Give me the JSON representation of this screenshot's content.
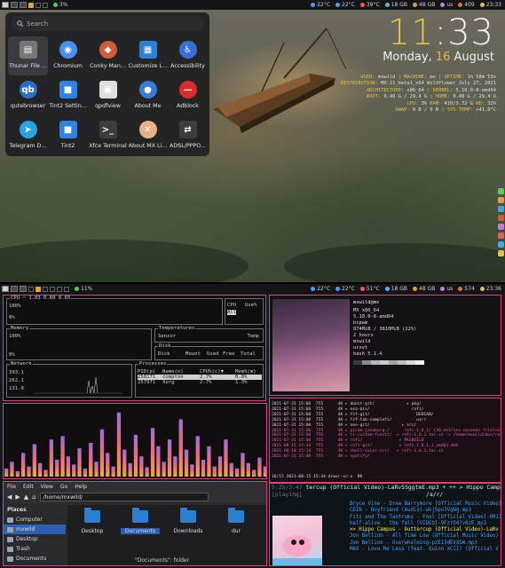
{
  "top_bar": {
    "cpu": "3%",
    "tray": [
      "22°C",
      "22°C",
      "39°C",
      "18 GB",
      "48 GB",
      "us",
      "409"
    ],
    "clock": "23:33"
  },
  "launcher": {
    "search_placeholder": "Search",
    "apps": [
      {
        "name": "Thunar File ...",
        "icon": "file-manager-icon",
        "color": "#777777",
        "glyph": "▤"
      },
      {
        "name": "Chromium",
        "icon": "chromium-icon",
        "color": "#4a8ef0",
        "glyph": "◉"
      },
      {
        "name": "Conky Man...",
        "icon": "conky-manager-icon",
        "color": "#d35c3a",
        "glyph": "◆"
      },
      {
        "name": "Customize L...",
        "icon": "customize-look-icon",
        "color": "#2d80d8",
        "glyph": "▦"
      },
      {
        "name": "Accessibility",
        "icon": "accessibility-icon",
        "color": "#3b6fd6",
        "glyph": "♿"
      },
      {
        "name": "qutebrowser",
        "icon": "qutebrowser-icon",
        "color": "#2e6fc1",
        "glyph": "qb"
      },
      {
        "name": "Tint2 Settin...",
        "icon": "tint2-settings-icon",
        "color": "#2f82e0",
        "glyph": "■"
      },
      {
        "name": "qpdfview",
        "icon": "qpdfview-icon",
        "color": "#dfdfdf",
        "glyph": "▣"
      },
      {
        "name": "About Me",
        "icon": "user-icon",
        "color": "#3a7bd5",
        "glyph": "●"
      },
      {
        "name": "Adblock",
        "icon": "adblock-icon",
        "color": "#d62e2e",
        "glyph": "—"
      },
      {
        "name": "Telegram D...",
        "icon": "telegram-icon",
        "color": "#2aa3e3",
        "glyph": "➤"
      },
      {
        "name": "Tint2",
        "icon": "tint2-icon",
        "color": "#2f82e0",
        "glyph": "■"
      },
      {
        "name": "Xfce Terminal",
        "icon": "terminal-icon",
        "color": "#3d3d3d",
        "glyph": ">_"
      },
      {
        "name": "About MX Li...",
        "icon": "mx-linux-icon",
        "color": "#e8b088",
        "glyph": "✕"
      },
      {
        "name": "ADSL/PPPO...",
        "icon": "network-icon",
        "color": "#3d3d3d",
        "glyph": "⇄"
      }
    ]
  },
  "clock": {
    "hour": "11",
    "minute": ":33",
    "weekday": "Monday, ",
    "day": "16",
    "month": " August"
  },
  "sysinfo": [
    {
      "k": "USER: ",
      "v": "mxwild",
      "k2": " | MACHINE: ",
      "v2": "mx",
      "k3": " | UPTIME: ",
      "v3": "1h 58m 53s"
    },
    {
      "k": "DISTRIBUTION: ",
      "v": "MX-21_beta1_x64 Wildflower July 27, 2021"
    },
    {
      "k": "ARCHITECTURE: ",
      "v": "x86_64",
      "k2": " | KERNEL: ",
      "v2": "5.10.0-8-amd64"
    },
    {
      "k": "ROOT: ",
      "v": "9.48 G / 29.4 G",
      "k2": " | HOME: ",
      "v2": "9.48 G / 29.4 G"
    },
    {
      "k": "CPU: ",
      "v": "3%",
      "k2": " RAM: ",
      "v2": "410/3.72 G",
      "k3": " HD: ",
      "v3": "32%"
    },
    {
      "k": "SWAP: ",
      "v": "0 B / 0 B",
      "k2": " | SYS TEMP: ",
      "v2": "+41.0°C"
    }
  ],
  "bottom_bar": {
    "cpu": "11%",
    "tray": [
      "22°C",
      "22°C",
      "51°C",
      "18 GB",
      "48 GB",
      "us",
      "574"
    ],
    "clock": "23:36"
  },
  "conky": {
    "cpu_title": "CPU",
    "cpu_load": "CPU ~ 1.03 0.60 0.65",
    "cpu_pct_top": "100%",
    "cpu_pct_bottom": "0%",
    "cpu_use_header": [
      "CPU",
      "Use%"
    ],
    "cpu_use_row": "All",
    "memory_title": "Memory",
    "mem_top": "100%",
    "mem_bottom": "0%",
    "temps_title": "Temperatures",
    "temps_header": [
      "Sensor",
      "Temp"
    ],
    "disk_title": "Disk",
    "disk_header": [
      "Disk",
      "Mount",
      "Used",
      "Free",
      "Total"
    ],
    "network_title": "Network",
    "net_values": [
      "393.1",
      "262.1",
      "131.0"
    ],
    "processes_title": "Processes",
    "proc_header": [
      "PID(p)",
      "Name(n)",
      "CPU%(c)▼",
      "Mem%(m)"
    ],
    "processes": [
      {
        "pid": "258171",
        "name": "compton",
        "cpu": "2.7%",
        "mem": "0.8%"
      },
      {
        "pid": "257971",
        "name": "Xorg",
        "cpu": "2.7%",
        "mem": "1.3%"
      }
    ]
  },
  "neofetch": {
    "user": "mxwild@mx",
    "lines": [
      "MX x86_64",
      "5.10.0-8-amd64",
      "bspwm",
      "874MiB / 3810MiB (22%)",
      "2 hours",
      "mxwild",
      "urxvt",
      "bash 5.1.4"
    ],
    "swatches": [
      "#3a3a3a",
      "#8a8a8a",
      "#b5b5b5",
      "#c9c9c9",
      "#a6a6a6",
      "#bdbdbd",
      "#d9d9d9",
      "#f0f0f0"
    ]
  },
  "ranger": {
    "lines": [
      "2021-07-31 15:06  755      4K ▸ dunst-git/             ▸ pkg/",
      "2021-07-31 15:06  755      4K ▸ exa-bin/                 rofi/",
      "2021-07-31 15:00  755      4K ▸ fzf-git/                   DEBIAN/",
      "2021-07-31 15:00  755      4K ▸ fzf-tab-completi/          usr/",
      "2021-07-31 15:00  755      4K ▸ neo-git/             ▸ src/",
      "2021-07-31 15:00  755      4K ▸ picom-jonaburg-/      rofi-1.6.1/ [36 entries exceeds filelimit, not opening dir]",
      "2021-07-31 15:00  755      4K ▸ ri-custom-functi/  ▸ rofi-1.6.1.tar.xz -> /home/mxwild/dur/rofi/rofi-1.6.1.tar.xz",
      "2021-07-31 15:00  755      4K ▸ rofi/               ▸ PKGBUILD",
      "2021-08-15 15:34  755      4K ▸ rofi-git/           ▸ rofi-1.6.1_1_amd64.deb",
      "2021-08-10 15:14  755      4K ▸ shell-color-scr/   ▸ rofi-1.6.1.tar.xz",
      "2021-07-31 15:00  755      4K ▸ spotify/"
    ],
    "status": "16/15 2021-08-15 15:34 drwxr-xr-x  8K"
  },
  "cava": {
    "bars": [
      0.12,
      0.22,
      0.08,
      0.35,
      0.15,
      0.48,
      0.2,
      0.1,
      0.55,
      0.25,
      0.6,
      0.3,
      0.18,
      0.42,
      0.12,
      0.5,
      0.22,
      0.7,
      0.35,
      0.15,
      0.95,
      0.4,
      0.2,
      0.62,
      0.3,
      0.14,
      0.72,
      0.45,
      0.22,
      0.55,
      0.3,
      0.85,
      0.4,
      0.18,
      0.6,
      0.25,
      0.45,
      0.15,
      0.3,
      0.55,
      0.2,
      0.12,
      0.35,
      0.2,
      0.1,
      0.28,
      0.15
    ]
  },
  "file_manager": {
    "menu": [
      "File",
      "Edit",
      "View",
      "Go",
      "Help"
    ],
    "path": "/home/mxwild/",
    "places_title": "Places",
    "places": [
      {
        "label": "Computer",
        "icon": "computer-icon",
        "selected": false
      },
      {
        "label": "mxwild",
        "icon": "home-icon",
        "selected": true
      },
      {
        "label": "Desktop",
        "icon": "desktop-icon",
        "selected": false
      },
      {
        "label": "Trash",
        "icon": "trash-icon",
        "selected": false
      },
      {
        "label": "Documents",
        "icon": "documents-icon",
        "selected": false
      }
    ],
    "folders": [
      {
        "label": "Desktop",
        "selected": false
      },
      {
        "label": "Documents",
        "selected": true
      },
      {
        "label": "Downloads",
        "selected": false
      },
      {
        "label": "dur",
        "selected": false
      }
    ],
    "status": "\"Documents\": folder"
  },
  "music": {
    "header_time": "5:25/3:47",
    "header_title": "tercup (Official Video)-LaRv5SggtmE.mp3 + ++ > Hippo Camp",
    "header_sub": "[playing]",
    "header_right": "/a/r/",
    "tracks": [
      {
        "text": "Bryce Vine - Drew Barrymore [Official Music Video]",
        "current": false
      },
      {
        "text": "CDIN - Boyfriend (Audio)-wkjSpoJVqNg.mp3",
        "current": false
      },
      {
        "text": "Fitz and The Tantrums - Fool [Official Video]-0M13",
        "current": false
      },
      {
        "text": "half-alive - the fall [VIDEO]-9FzrO47v0zE.mp3",
        "current": false
      },
      {
        "text": ">> Hippo Campus - buttercup (Official Video)-LaRv",
        "current": true
      },
      {
        "text": "Jon Bellion - All Time Low (Official Music Video)",
        "current": false
      },
      {
        "text": "Jon Bellion - Overwhelming-pzEI3dEVXSW.mp3",
        "current": false
      },
      {
        "text": "MAX - Love Me Less (feat. Quinn XCII) (Official V",
        "current": false
      }
    ]
  }
}
